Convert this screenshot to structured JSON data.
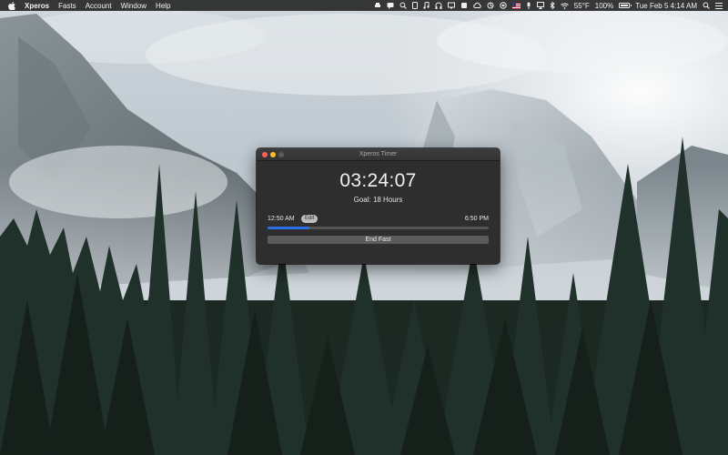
{
  "menubar": {
    "app_name": "Xperos",
    "menus": [
      "Fasts",
      "Account",
      "Window",
      "Help"
    ],
    "temperature": "55°F",
    "battery_percent": "100%",
    "clock": "Tue Feb 5  4:14 AM"
  },
  "icons": {
    "apple": "apple-icon",
    "status": [
      "print-icon",
      "chat-icon",
      "search-icon",
      "phone-icon",
      "music-icon",
      "headphones-icon",
      "monitor-icon",
      "mail-icon",
      "cloud-icon",
      "sync-icon",
      "dropbox-icon",
      "flag-icon",
      "mic-icon",
      "airplay-icon",
      "bluetooth-icon",
      "wifi-icon",
      "battery-icon",
      "search-icon",
      "list-icon"
    ]
  },
  "window": {
    "title": "Xperos Timer",
    "timer": "03:24:07",
    "goal": "Goal: 18 Hours",
    "start_time": "12:50 AM",
    "edit_label": "Edit",
    "end_time": "6:50 PM",
    "progress": 0.19,
    "end_fast_label": "End Fast"
  },
  "colors": {
    "accent": "#2b6fe8",
    "close": "#ff5f57",
    "minimize": "#ffbd2e",
    "window_bg": "#2e2e2e"
  }
}
